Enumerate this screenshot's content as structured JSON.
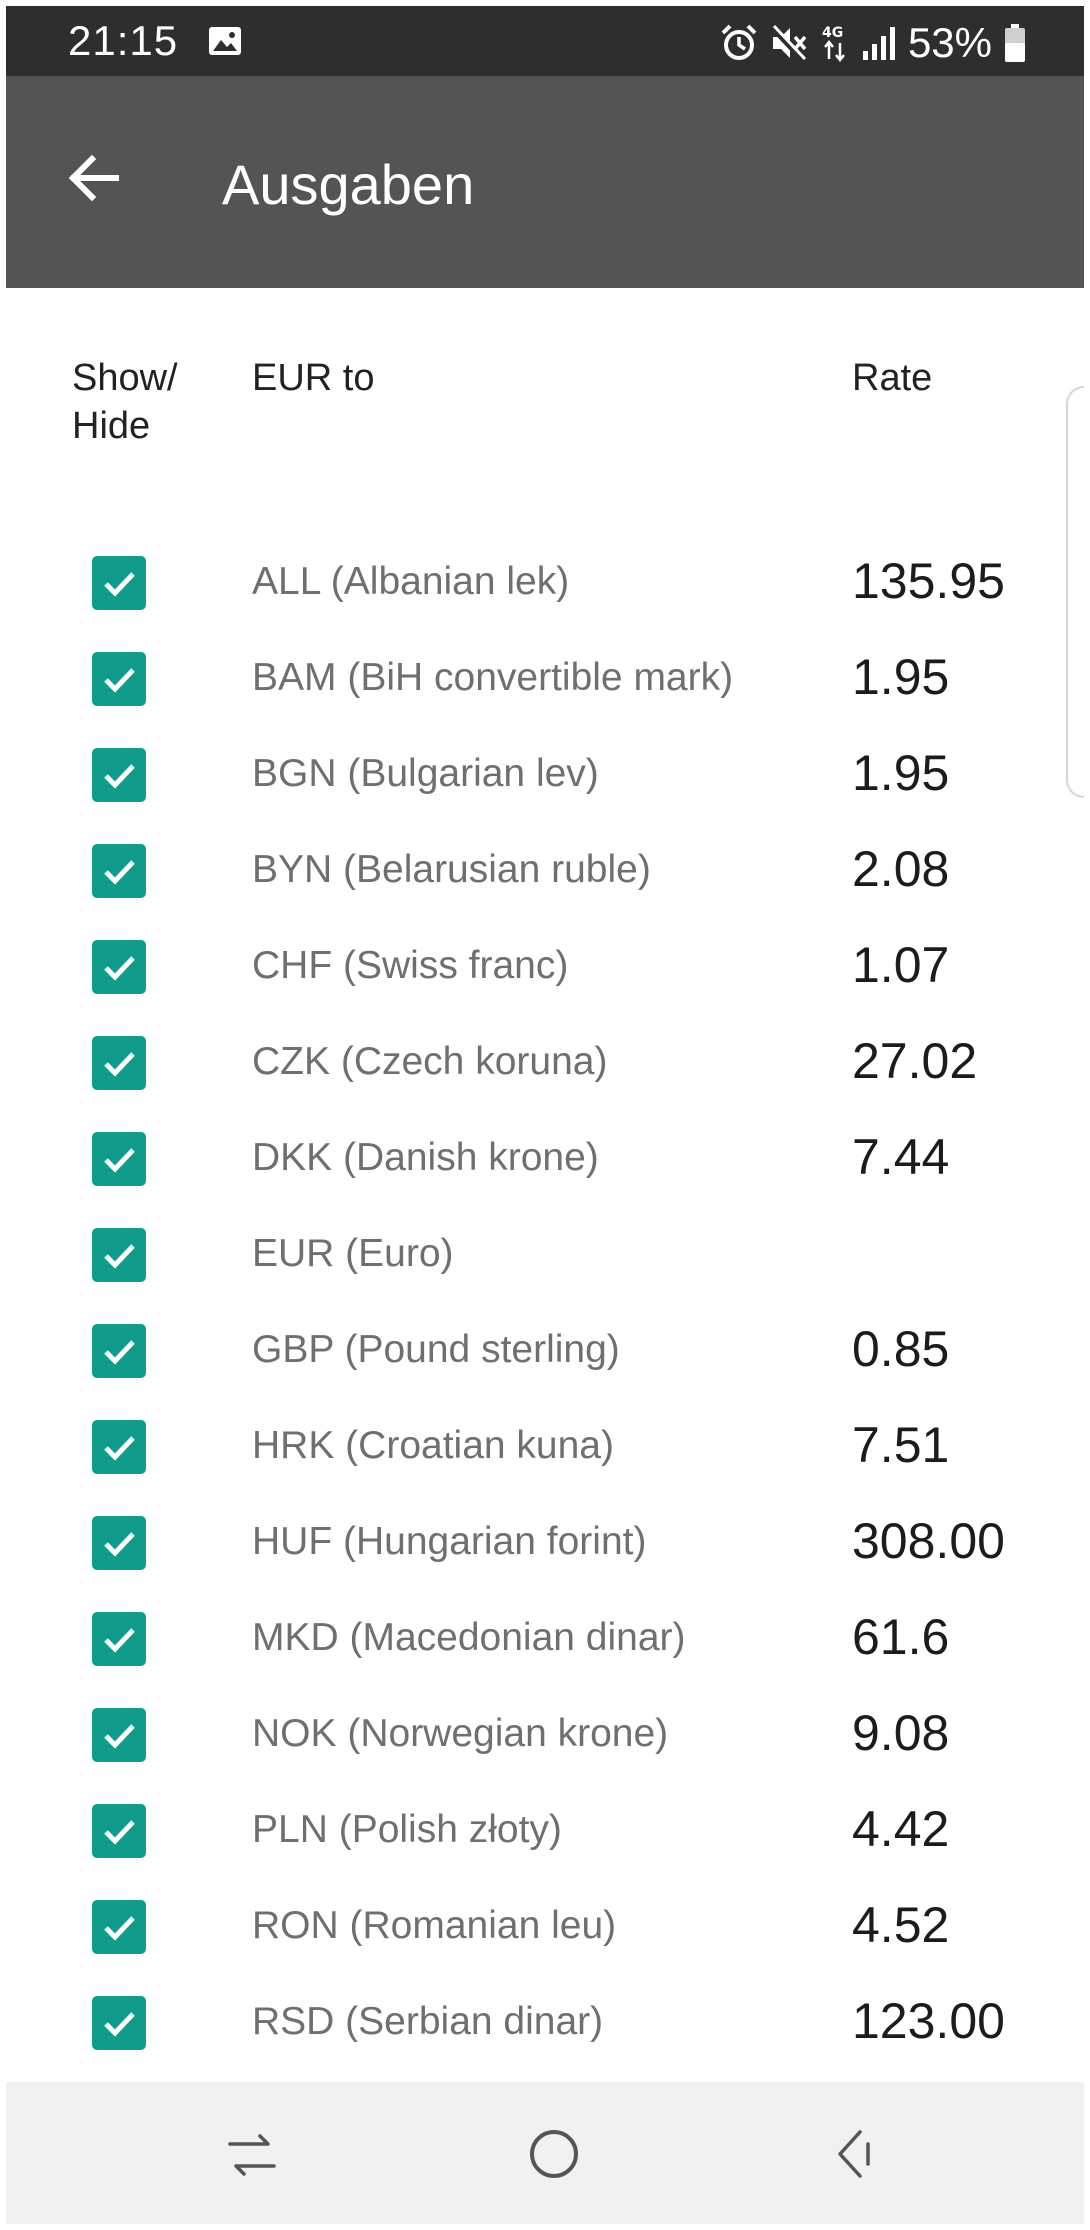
{
  "status_bar": {
    "time": "21:15",
    "battery_percent": "53%",
    "icons": [
      "gallery-icon",
      "alarm-icon",
      "mute-icon",
      "4g-icon",
      "signal-icon",
      "battery-icon"
    ]
  },
  "app_bar": {
    "title": "Ausgaben",
    "back_icon": "arrow-left-icon",
    "background_color": "#545454"
  },
  "table": {
    "headers": {
      "show_hide_line1": "Show/",
      "show_hide_line2": "Hide",
      "currency": "EUR to",
      "rate": "Rate"
    },
    "checkbox_color": "#119b8a",
    "rows": [
      {
        "currency": "ALL (Albanian lek)",
        "rate": "135.95",
        "checked": true
      },
      {
        "currency": "BAM (BiH convertible mark)",
        "rate": "1.95",
        "checked": true
      },
      {
        "currency": "BGN (Bulgarian lev)",
        "rate": "1.95",
        "checked": true
      },
      {
        "currency": "BYN (Belarusian ruble)",
        "rate": "2.08",
        "checked": true
      },
      {
        "currency": "CHF (Swiss franc)",
        "rate": "1.07",
        "checked": true
      },
      {
        "currency": "CZK (Czech koruna)",
        "rate": "27.02",
        "checked": true
      },
      {
        "currency": "DKK (Danish krone)",
        "rate": "7.44",
        "checked": true
      },
      {
        "currency": "EUR (Euro)",
        "rate": "",
        "checked": true
      },
      {
        "currency": "GBP (Pound sterling)",
        "rate": "0.85",
        "checked": true
      },
      {
        "currency": "HRK (Croatian kuna)",
        "rate": "7.51",
        "checked": true
      },
      {
        "currency": "HUF (Hungarian forint)",
        "rate": "308.00",
        "checked": true
      },
      {
        "currency": "MKD (Macedonian dinar)",
        "rate": "61.6",
        "checked": true
      },
      {
        "currency": "NOK (Norwegian krone)",
        "rate": "9.08",
        "checked": true
      },
      {
        "currency": "PLN (Polish złoty)",
        "rate": "4.42",
        "checked": true
      },
      {
        "currency": "RON (Romanian leu)",
        "rate": "4.52",
        "checked": true
      },
      {
        "currency": "RSD (Serbian dinar)",
        "rate": "123.00",
        "checked": true
      }
    ]
  },
  "nav_bar": {
    "icons": [
      "recents-icon",
      "home-icon",
      "back-icon"
    ]
  }
}
